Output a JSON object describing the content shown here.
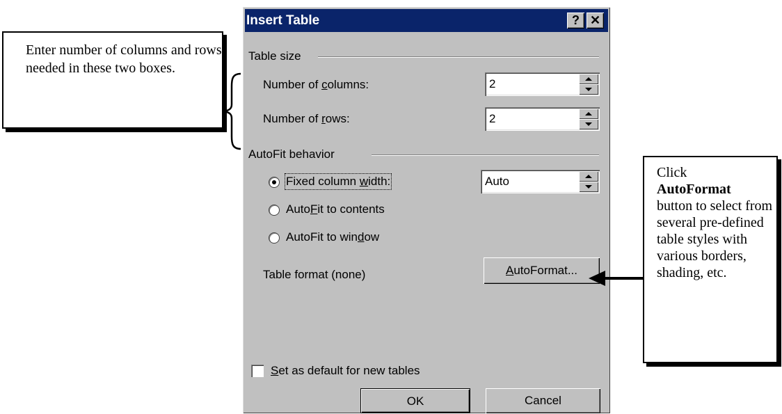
{
  "dialog": {
    "title": "Insert Table",
    "help_label": "?",
    "close_label": "✕",
    "table_size": {
      "group_label": "Table size",
      "columns_label_before": "Number of ",
      "columns_label_accel": "c",
      "columns_label_after": "olumns:",
      "columns_value": "2",
      "rows_label_before": "Number of ",
      "rows_label_accel": "r",
      "rows_label_after": "ows:",
      "rows_value": "2"
    },
    "autofit": {
      "group_label": "AutoFit behavior",
      "fixed_before": "Fixed column ",
      "fixed_accel": "w",
      "fixed_after": "idth:",
      "fixed_value": "Auto",
      "contents_before": "Auto",
      "contents_accel": "F",
      "contents_after": "it to contents",
      "window_before": "AutoFit to win",
      "window_accel": "d",
      "window_after": "ow",
      "selected": "fixed"
    },
    "table_format_label": "Table format  (none)",
    "autoformat_accel": "A",
    "autoformat_rest": "utoFormat...",
    "default_accel": "S",
    "default_rest": "et as default for new tables",
    "default_checked": false,
    "ok_label": "OK",
    "cancel_label": "Cancel"
  },
  "callouts": {
    "left_text": "Enter number of columns and rows needed in these two boxes.",
    "right_line1": "Click",
    "right_bold": "AutoFormat",
    "right_rest": "button to select from several pre-defined table styles with various borders, shading, etc."
  },
  "colors": {
    "dialog_face": "#c0c0c0",
    "titlebar": "#0a246a",
    "title_text": "#ffffff"
  }
}
